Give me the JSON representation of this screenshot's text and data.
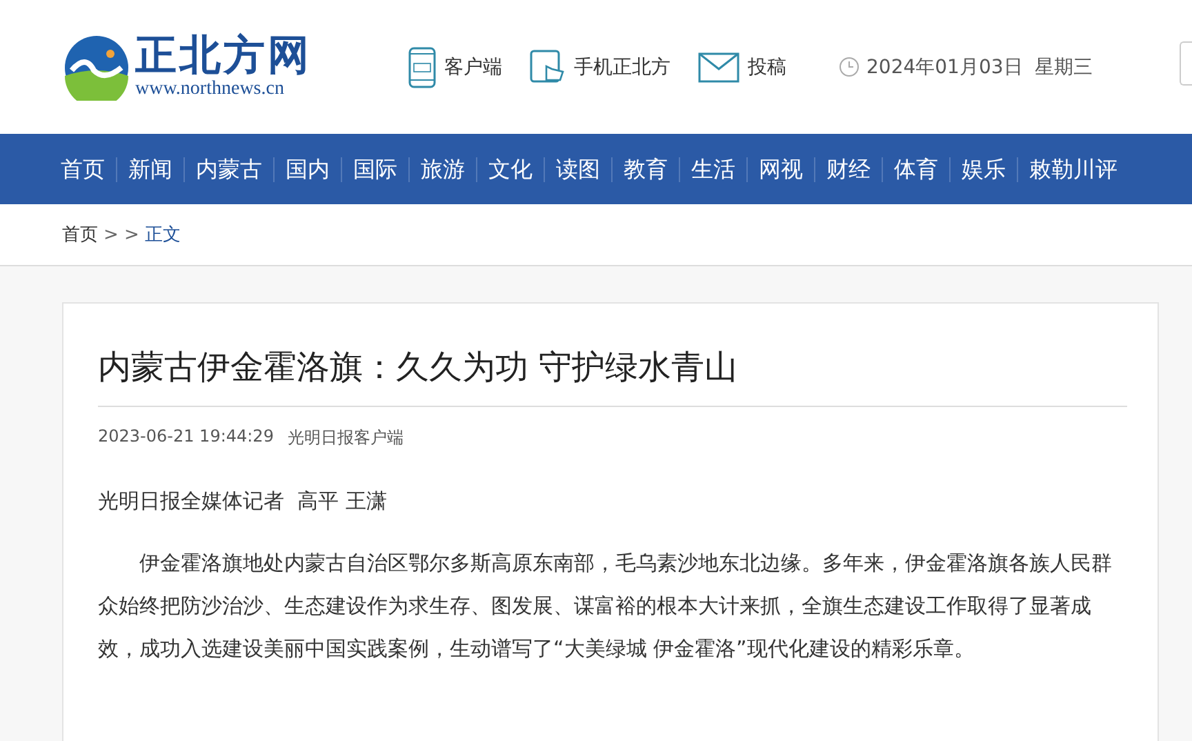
{
  "logo": {
    "name": "正北方网",
    "url": "www.northnews.cn"
  },
  "header_links": [
    {
      "kind": "app",
      "label": "客户端"
    },
    {
      "kind": "mobile",
      "label": "手机正北方"
    },
    {
      "kind": "mail",
      "label": "投稿"
    }
  ],
  "date": "2024年01月03日  星期三",
  "nav": [
    {
      "label": "首页"
    },
    {
      "label": "新闻"
    },
    {
      "label": "内蒙古"
    },
    {
      "label": "国内"
    },
    {
      "label": "国际"
    },
    {
      "label": "旅游"
    },
    {
      "label": "文化"
    },
    {
      "label": "读图"
    },
    {
      "label": "教育"
    },
    {
      "label": "生活"
    },
    {
      "label": "网视"
    },
    {
      "label": "财经"
    },
    {
      "label": "体育"
    },
    {
      "label": "娱乐"
    },
    {
      "label": "敕勒川评"
    }
  ],
  "breadcrumb": {
    "home": "首页",
    "separator": "> >",
    "current": "正文"
  },
  "article": {
    "title": "内蒙古伊金霍洛旗：久久为功 守护绿水青山",
    "time": "2023-06-21 19:44:29",
    "source": "光明日报客户端",
    "byline": "光明日报全媒体记者  高平 王潇",
    "paragraphs": [
      "伊金霍洛旗地处内蒙古自治区鄂尔多斯高原东南部，毛乌素沙地东北边缘。多年来，伊金霍洛旗各族人民群众始终把防沙治沙、生态建设作为求生存、图发展、谋富裕的根本大计来抓，全旗生态建设工作取得了显著成效，成功入选建设美丽中国实践案例，生动谱写了“大美绿城 伊金霍洛”现代化建设的精彩乐章。"
    ]
  }
}
